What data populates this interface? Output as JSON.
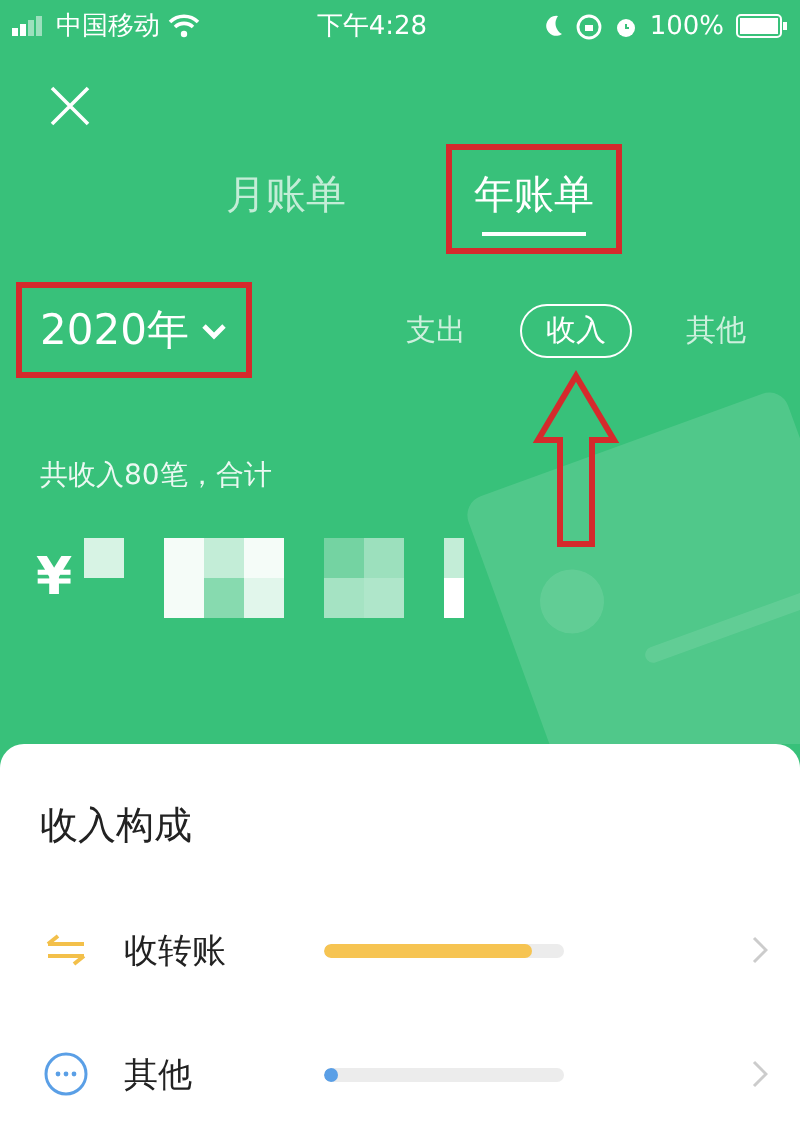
{
  "status_bar": {
    "carrier": "中国移动",
    "time": "下午4:28",
    "battery": "100%"
  },
  "tabs": [
    {
      "label": "月账单",
      "selected": false,
      "annotated": false
    },
    {
      "label": "年账单",
      "selected": true,
      "annotated": true
    }
  ],
  "year_selector": {
    "label": "2020年",
    "annotated": true
  },
  "filters": [
    {
      "label": "支出",
      "selected": false,
      "pointed": false
    },
    {
      "label": "收入",
      "selected": true,
      "pointed": true
    },
    {
      "label": "其他",
      "selected": false,
      "pointed": false
    }
  ],
  "summary": "共收入80笔，合计",
  "currency": "¥",
  "breakdown": {
    "title": "收入构成",
    "rows": [
      {
        "kind": "transfer",
        "label": "收转账",
        "level": 0.87,
        "color": "#f6c452"
      },
      {
        "kind": "other",
        "label": "其他",
        "level": 0.03,
        "color": "#5a9fe6"
      }
    ]
  }
}
